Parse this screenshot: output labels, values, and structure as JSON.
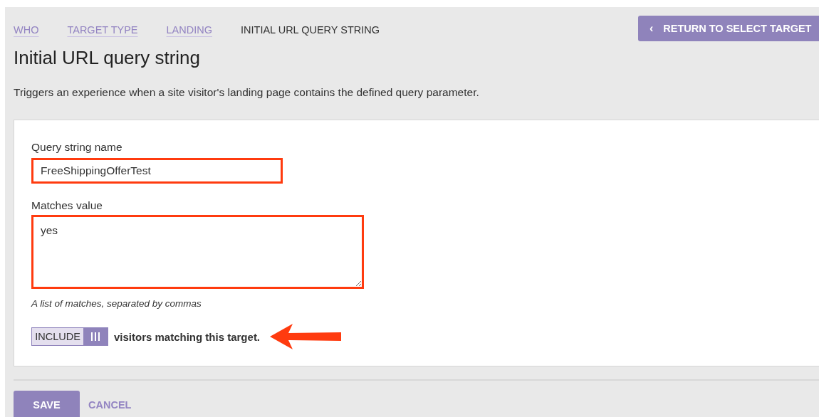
{
  "breadcrumbs": [
    {
      "label": "WHO",
      "current": false
    },
    {
      "label": "TARGET TYPE",
      "current": false
    },
    {
      "label": "LANDING",
      "current": false
    },
    {
      "label": "INITIAL URL QUERY STRING",
      "current": true
    }
  ],
  "return_button": {
    "icon": "‹",
    "label": "RETURN TO SELECT TARGET"
  },
  "title": "Initial URL query string",
  "description": "Triggers an experience when a site visitor's landing page contains the defined query parameter.",
  "form": {
    "name_field": {
      "label": "Query string name",
      "value": "FreeShippingOfferTest",
      "highlighted": true
    },
    "matches_field": {
      "label": "Matches value",
      "value": "yes",
      "highlighted": true,
      "hint": "A list of matches, separated by commas"
    },
    "include_toggle": {
      "label": "INCLUDE",
      "on": true,
      "suffix": "visitors matching this target.",
      "arrow_annotation": true
    }
  },
  "buttons": [
    {
      "label": "SAVE",
      "kind": "primary"
    },
    {
      "label": "CANCEL",
      "kind": "link"
    }
  ]
}
